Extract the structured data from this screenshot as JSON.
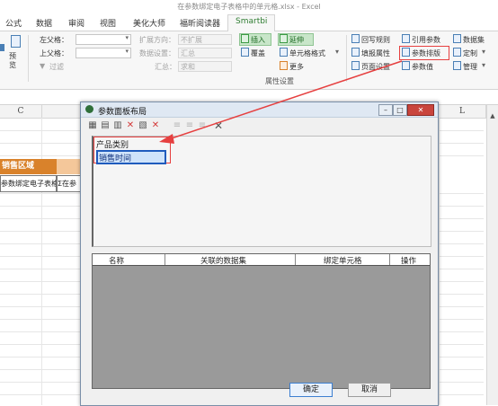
{
  "window": {
    "title": "在参数绑定电子表格中的单元格.xlsx - Excel"
  },
  "menu_tabs": [
    {
      "label": "公式"
    },
    {
      "label": "数据"
    },
    {
      "label": "审阅"
    },
    {
      "label": "视图"
    },
    {
      "label": "美化大师"
    },
    {
      "label": "福昕阅读器"
    },
    {
      "label": "Smartbi"
    }
  ],
  "ribbon": {
    "preview_label": "预览",
    "left_parent_label": "左父格：",
    "top_parent_label": "上父格：",
    "filter_label": "过滤",
    "expand_direction_label": "扩展方向：",
    "expand_direction_value": "不扩展",
    "data_setting_label": "数据设置：",
    "data_setting_value": "汇总",
    "aggregate_label": "汇总：",
    "aggregate_value": "求和",
    "insert_label": "插入",
    "overwrite_label": "覆盖",
    "extend_label": "延伸",
    "cell_format_label": "单元格格式",
    "more_label": "更多",
    "attribute_group_label": "属性设置",
    "writeback_rule_label": "回写规则",
    "fill_attr_label": "填报属性",
    "page_setup_label": "页面设置",
    "ref_param_label": "引用参数",
    "param_layout_label": "参数排版",
    "param_value_label": "参数值",
    "dataset_label": "数据集",
    "customize_label": "定制",
    "manage_label": "管理"
  },
  "sheet": {
    "col_c": "C",
    "col_l": "L",
    "sales_area_label": "销售区域",
    "cell_text_1": "参数绑定电子表格",
    "cell_text_2": "Σ在参"
  },
  "dialog": {
    "title": "参数面板布局",
    "params": [
      "产品类别",
      "销售时间"
    ],
    "table_headers": [
      "名称",
      "关联的数据集",
      "绑定单元格",
      "操作"
    ],
    "ok_label": "确定",
    "cancel_label": "取消"
  },
  "colors": {
    "accent_green": "#2f7d32",
    "highlight_red": "#e64040",
    "selection_blue": "#1f5bbd",
    "sales_area_fill": "#d9822b"
  }
}
